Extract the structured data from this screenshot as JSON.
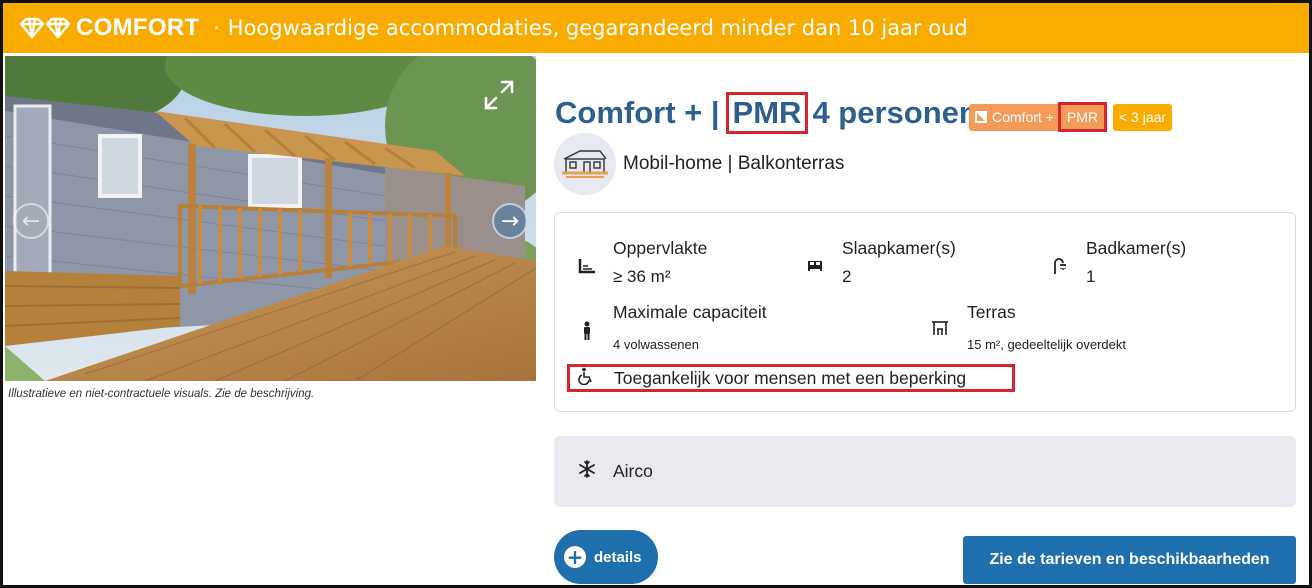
{
  "banner": {
    "brand": "COMFORT",
    "separator": "·",
    "tagline": "Hoogwaardige accommodaties, gegarandeerd minder dan 10 jaar oud",
    "color": "#f9ab00"
  },
  "gallery": {
    "caption": "Illustratieve en niet-contractuele visuals. Zie de beschrijving.",
    "prev_icon": "chevron-left-icon",
    "next_icon": "chevron-right-icon",
    "expand_icon": "expand-icon"
  },
  "accommodation": {
    "title_prefix": "Comfort + |",
    "title_pmr": "PMR",
    "title_suffix": "4 personen",
    "title_color": "#2f5f8f",
    "badges": {
      "comfort": "Comfort +",
      "pmr": "PMR",
      "age": "< 3 jaar"
    },
    "type": "Mobil-home | Balkonterras"
  },
  "features": {
    "area": {
      "label": "Oppervlakte",
      "value": "≥ 36 m²",
      "icon": "area-icon"
    },
    "bedrooms": {
      "label": "Slaapkamer(s)",
      "value": "2",
      "icon": "bed-icon"
    },
    "bathrooms": {
      "label": "Badkamer(s)",
      "value": "1",
      "icon": "shower-icon"
    },
    "capacity": {
      "label": "Maximale capaciteit",
      "value": "4 volwassenen",
      "icon": "person-icon"
    },
    "terrace": {
      "label": "Terras",
      "value": "15 m², gedeeltelijk overdekt",
      "icon": "terrace-icon"
    },
    "accessibility": {
      "label": "Toegankelijk voor mensen met een beperking",
      "icon": "wheelchair-icon"
    }
  },
  "equipment": {
    "airco": {
      "label": "Airco",
      "icon": "snowflake-icon"
    }
  },
  "actions": {
    "details": "details",
    "rates": "Zie de tarieven en beschikbaarheden"
  },
  "colors": {
    "accent_blue": "#1f6fad",
    "highlight_red": "#d9232e",
    "badge_orange": "#f49b5a"
  }
}
